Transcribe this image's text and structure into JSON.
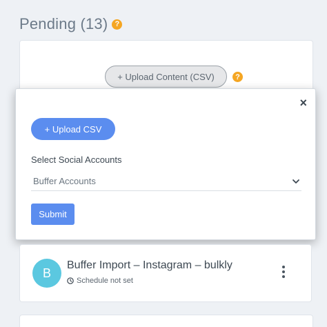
{
  "pending": {
    "title": "Pending (13)",
    "help_glyph": "?"
  },
  "top_card": {
    "upload_content_label": "+ Upload Content (CSV)",
    "help_glyph": "?"
  },
  "modal": {
    "close_glyph": "×",
    "upload_csv_label": "+ Upload CSV",
    "select_label": "Select Social Accounts",
    "select_value": "Buffer Accounts",
    "submit_label": "Submit"
  },
  "item": {
    "avatar_letter": "B",
    "title": "Buffer Import – Instagram – bulkly",
    "schedule": "Schedule not set"
  },
  "colors": {
    "accent": "#5b8def",
    "help": "#f5a623",
    "avatar": "#5bc8e0"
  }
}
